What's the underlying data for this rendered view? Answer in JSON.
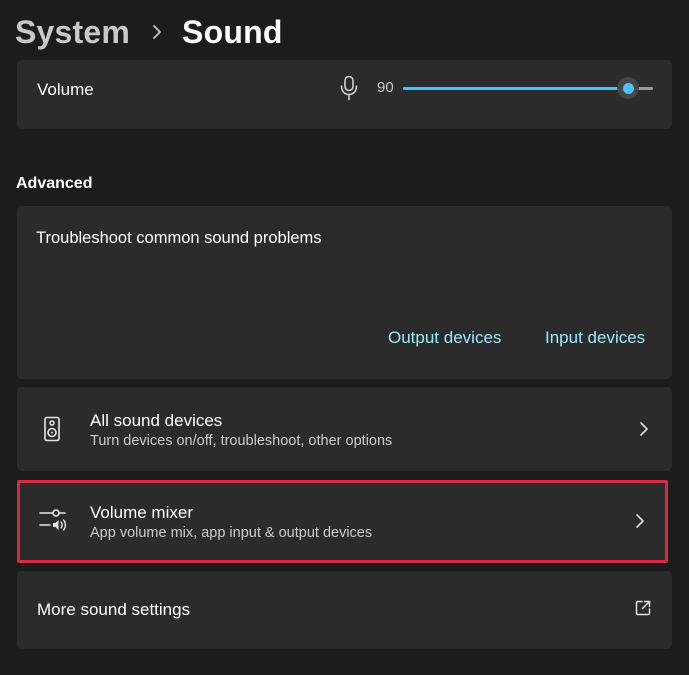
{
  "breadcrumb": {
    "parent": "System",
    "current": "Sound"
  },
  "volume": {
    "label": "Volume",
    "value": "90",
    "level_percent": 90,
    "icon": "microphone-icon",
    "accent_color": "#4cc2ff"
  },
  "advanced": {
    "heading": "Advanced",
    "troubleshoot": {
      "title": "Troubleshoot common sound problems",
      "output_link": "Output devices",
      "input_link": "Input devices",
      "link_color": "#99ebff"
    },
    "all_sound_devices": {
      "title": "All sound devices",
      "subtitle": "Turn devices on/off, troubleshoot, other options",
      "icon": "speaker-icon"
    },
    "volume_mixer": {
      "title": "Volume mixer",
      "subtitle": "App volume mix, app input & output devices",
      "icon": "mixer-icon",
      "highlight_color": "#d42a44"
    },
    "more_sound_settings": {
      "title": "More sound settings",
      "icon": "external-link-icon"
    }
  }
}
